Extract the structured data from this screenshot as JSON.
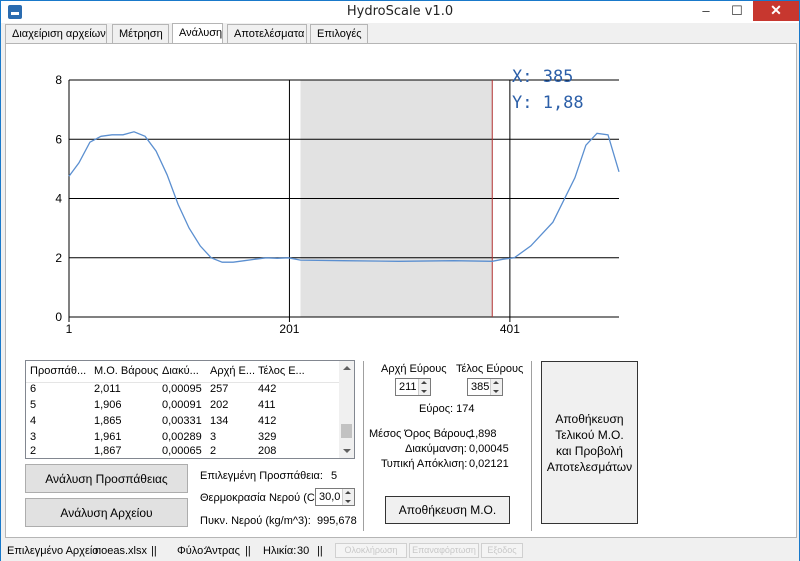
{
  "window": {
    "title": "HydroScale v1.0",
    "minimize": "–",
    "maximize": "☐",
    "close": "✕",
    "icon": "app-icon"
  },
  "tabs": [
    {
      "label": "Διαχείριση αρχείων"
    },
    {
      "label": "Μέτρηση"
    },
    {
      "label": "Ανάλυση"
    },
    {
      "label": "Αποτελέσματα"
    },
    {
      "label": "Επιλογές"
    }
  ],
  "chart_data": {
    "type": "line",
    "xlim": [
      1,
      500
    ],
    "ylim": [
      0,
      8
    ],
    "x_ticks": [
      "1",
      "201",
      "401"
    ],
    "y_ticks": [
      "0",
      "2",
      "4",
      "6",
      "8"
    ],
    "cursor_readout": {
      "x": "X: 385",
      "y": "Y: 1,88"
    },
    "selection": {
      "start": 211,
      "end": 385
    },
    "cursor_x": 385,
    "colors": {
      "line": "#5b8fd0",
      "selection": "#e2e2e2",
      "cursor": "#b03030",
      "readout": "#2c5fa8"
    },
    "series": [
      {
        "x": [
          1,
          10,
          20,
          30,
          40,
          50,
          60,
          70,
          80,
          90,
          100,
          110,
          120,
          130,
          140,
          150,
          160,
          170,
          180,
          190,
          200,
          211,
          250,
          300,
          350,
          385,
          395,
          405,
          420,
          440,
          460,
          470,
          480,
          490,
          500
        ],
        "y": [
          4.75,
          5.2,
          5.9,
          6.1,
          6.15,
          6.15,
          6.25,
          6.1,
          5.6,
          4.8,
          3.8,
          3.0,
          2.4,
          2.0,
          1.85,
          1.85,
          1.9,
          1.95,
          2.0,
          1.98,
          2.0,
          1.92,
          1.9,
          1.88,
          1.9,
          1.88,
          1.95,
          2.0,
          2.4,
          3.2,
          4.7,
          5.8,
          6.2,
          6.15,
          4.9
        ]
      }
    ]
  },
  "table": {
    "headers": [
      "Προσπάθ...",
      "Μ.Ο. Βάρους",
      "Διακύ...",
      "Αρχή Ε...",
      "Τέλος Ε..."
    ],
    "rows": [
      [
        "6",
        "2,011",
        "0,00095",
        "257",
        "442"
      ],
      [
        "5",
        "1,906",
        "0,00091",
        "202",
        "411"
      ],
      [
        "4",
        "1,865",
        "0,00331",
        "134",
        "412"
      ],
      [
        "3",
        "1,961",
        "0,00289",
        "3",
        "329"
      ],
      [
        "2",
        "1,867",
        "0,00065",
        "2",
        "208"
      ]
    ]
  },
  "analysis": {
    "analyze_attempt_button": "Ανάλυση Προσπάθειας",
    "analyze_file_button": "Ανάλυση Αρχείου",
    "selected_attempt_label": "Επιλεγμένη Προσπάθεια:",
    "selected_attempt_value": "5",
    "water_temp_label": "Θερμοκρασία Νερού (C):",
    "water_temp_value": "30,0",
    "water_density_label": "Πυκν. Νερού (kg/m^3):",
    "water_density_value": "995,678"
  },
  "range": {
    "start_label": "Αρχή Εύρους",
    "start_value": "211",
    "end_label": "Τέλος Εύρους",
    "end_value": "385",
    "width_text": "Εύρος: 174",
    "mean_label": "Μέσος Όρος Βάρους:",
    "mean_value": "1,898",
    "variance_label": "Διακύμανση:",
    "variance_value": "0,00045",
    "std_label": "Τυπική Απόκλιση:",
    "std_value": "0,02121",
    "save_mean_button": "Αποθήκευση Μ.Ο."
  },
  "final": {
    "button_label": "Αποθήκευση Τελικού Μ.Ο. και Προβολή Αποτελεσμάτων"
  },
  "status": {
    "file_label": "Επιλεγμένο Αρχείο:",
    "file_value": "noeas.xlsx",
    "sex_label": "Φύλο:",
    "sex_value": "Άντρας",
    "age_label": "Ηλικία:",
    "age_value": "30",
    "separator": "||",
    "disabled_buttons": [
      "Ολοκλήρωση",
      "Επαναφόρτωση",
      "Εξοδος"
    ]
  }
}
